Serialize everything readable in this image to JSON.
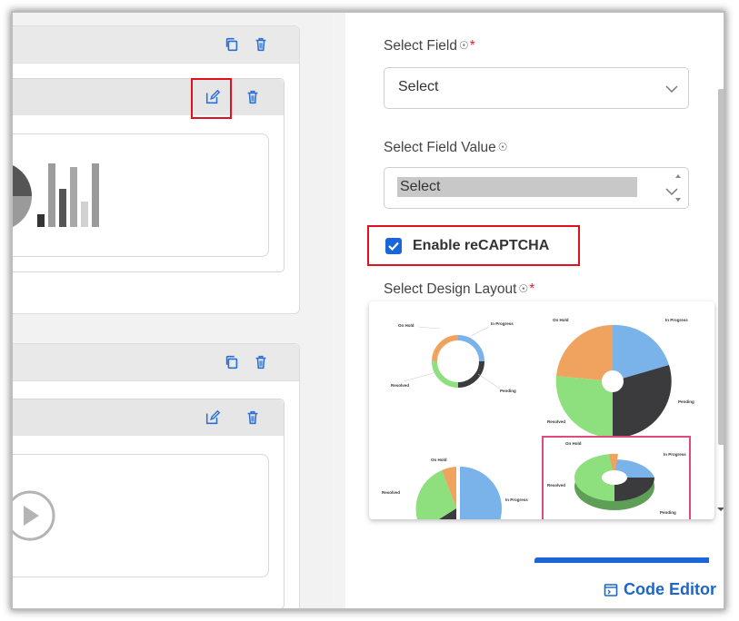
{
  "right_panel": {
    "select_field": {
      "label": "Select Field",
      "help": "☉",
      "required": "*",
      "value": "Select"
    },
    "select_field_value": {
      "label": "Select Field Value",
      "help": "☉",
      "value": "Select"
    },
    "recaptcha": {
      "label": "Enable reCAPTCHA",
      "checked": true
    },
    "design_layout": {
      "label": "Select Design Layout",
      "help": "☉",
      "required": "*",
      "layouts": [
        {
          "name": "donut",
          "labels": [
            "On Hold",
            "In Progress",
            "Resolved",
            "Pending"
          ]
        },
        {
          "name": "pie-with-hole",
          "labels": [
            "On Hold",
            "In Progress",
            "Resolved",
            "Pending"
          ]
        },
        {
          "name": "pie",
          "labels": [
            "On Hold",
            "In Progress",
            "Resolved"
          ]
        },
        {
          "name": "3d-donut",
          "labels": [
            "On Hold",
            "In Progress",
            "Resolved",
            "Pending"
          ],
          "selected": true
        }
      ]
    },
    "code_editor": {
      "label": "Code Editor"
    }
  },
  "left_canvas": {
    "widgets": [
      {
        "type": "chart",
        "icons": [
          "copy-icon",
          "trash-icon",
          "edit-icon",
          "trash-icon"
        ]
      },
      {
        "type": "video",
        "icons": [
          "copy-icon",
          "trash-icon",
          "edit-icon",
          "trash-icon"
        ]
      }
    ]
  },
  "colors": {
    "accent": "#1a66d9",
    "highlight": "#e0101e",
    "chart_blue": "#7ab3ea",
    "chart_orange": "#f0a35e",
    "chart_green": "#8ee07e",
    "chart_dark": "#3b3b3e"
  }
}
